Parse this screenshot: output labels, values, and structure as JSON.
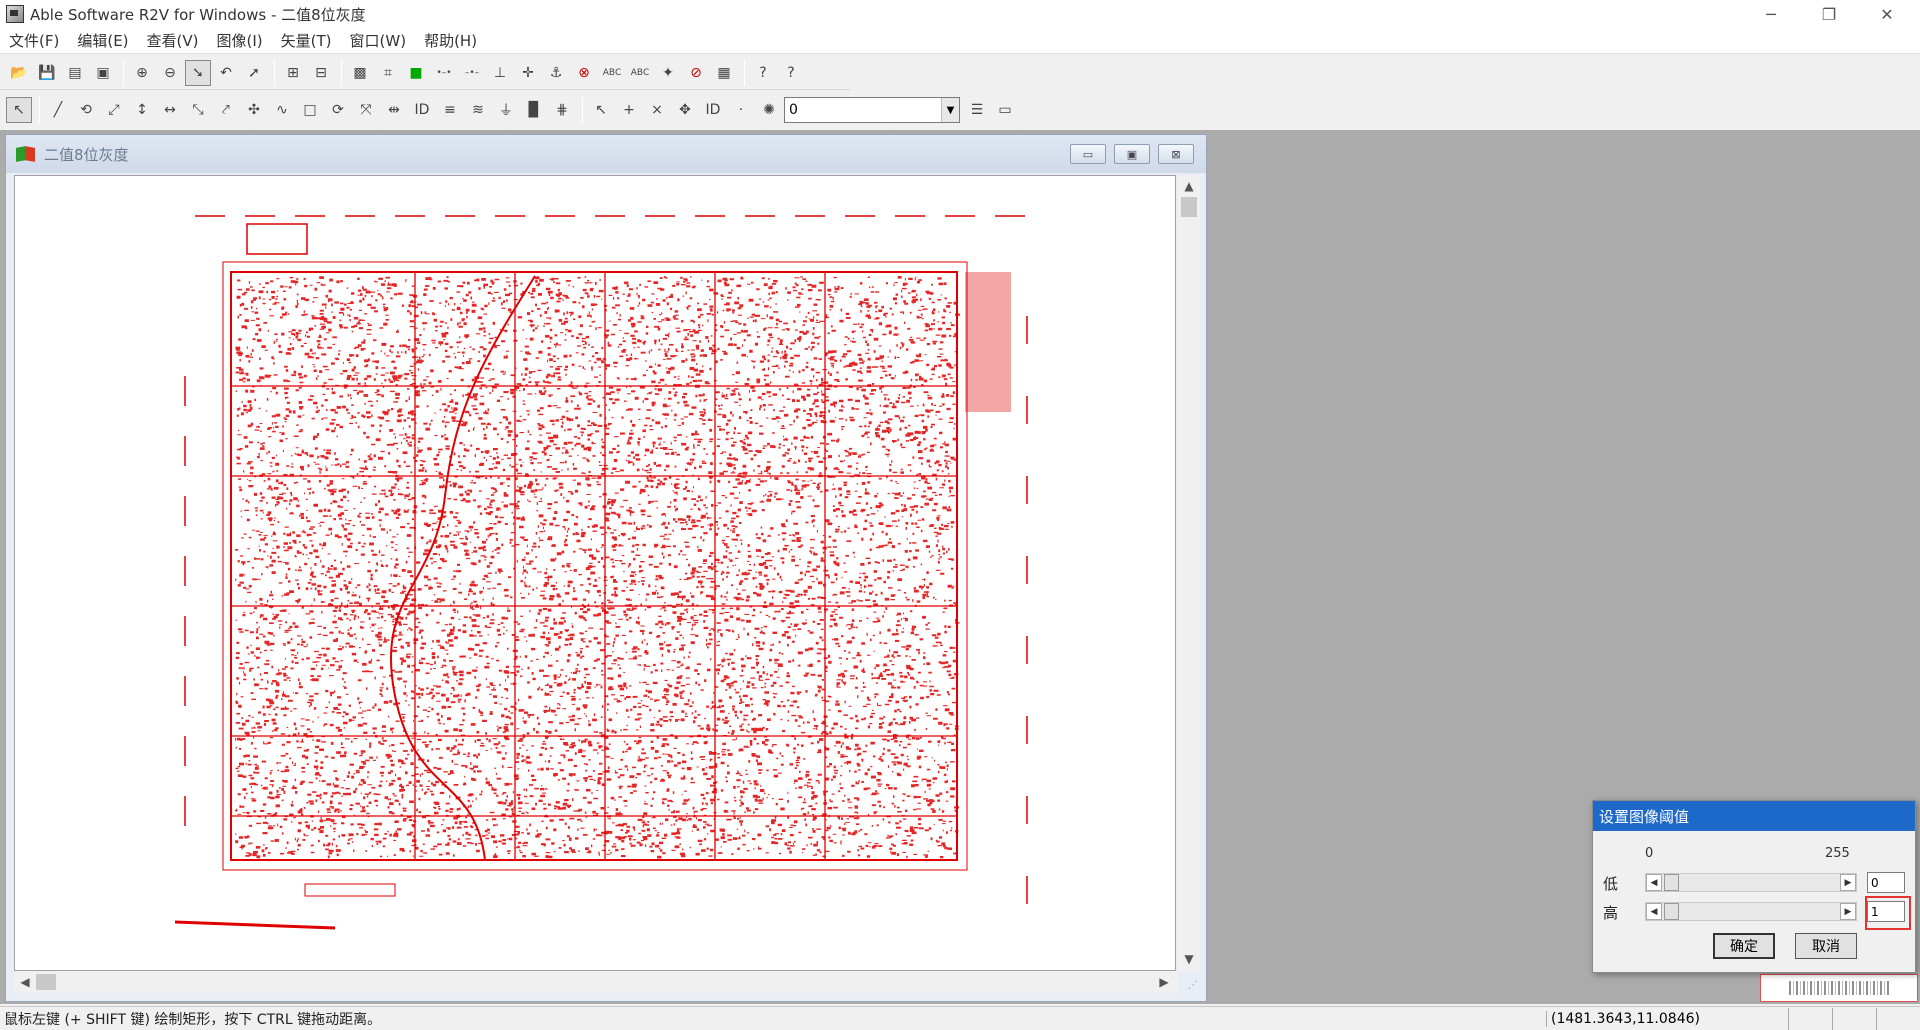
{
  "app": {
    "title": "Able Software R2V for Windows - 二值8位灰度",
    "icon": "r2v-app-icon",
    "window_controls": {
      "minimize": "─",
      "maximize": "❐",
      "close": "✕"
    }
  },
  "menu": [
    {
      "label": "文件(F)"
    },
    {
      "label": "编辑(E)"
    },
    {
      "label": "查看(V)"
    },
    {
      "label": "图像(I)"
    },
    {
      "label": "矢量(T)"
    },
    {
      "label": "窗口(W)"
    },
    {
      "label": "帮助(H)"
    }
  ],
  "toolbar1": {
    "buttons": [
      {
        "name": "open-icon",
        "glyph": "📂"
      },
      {
        "name": "save-icon",
        "glyph": "💾"
      },
      {
        "name": "print-icon",
        "glyph": "▤"
      },
      {
        "name": "save-all-icon",
        "glyph": "▣"
      },
      {
        "name": "zoom-in-icon",
        "glyph": "⊕"
      },
      {
        "name": "zoom-out-icon",
        "glyph": "⊖"
      },
      {
        "name": "select-arrow-icon",
        "glyph": "➘"
      },
      {
        "name": "undo-icon",
        "glyph": "↶"
      },
      {
        "name": "pointer-icon",
        "glyph": "➚"
      },
      {
        "name": "fit-width-icon",
        "glyph": "⊞"
      },
      {
        "name": "fit-height-icon",
        "glyph": "⊟"
      },
      {
        "name": "image-color-icon",
        "glyph": "▩"
      },
      {
        "name": "crop-icon",
        "glyph": "⌗"
      },
      {
        "name": "green-square-icon",
        "glyph": "■"
      },
      {
        "name": "node-link-icon",
        "glyph": "•–•"
      },
      {
        "name": "node-icon",
        "glyph": "–•–"
      },
      {
        "name": "split-icon",
        "glyph": "⊥"
      },
      {
        "name": "cross-icon",
        "glyph": "✛"
      },
      {
        "name": "anchor-icon",
        "glyph": "⚓"
      },
      {
        "name": "delete-icon",
        "glyph": "⊗"
      },
      {
        "name": "ocr-icon",
        "glyph": "ABC"
      },
      {
        "name": "ocr-label-icon",
        "glyph": "ABC"
      },
      {
        "name": "target-icon",
        "glyph": "✦"
      },
      {
        "name": "stop-pick-icon",
        "glyph": "⊘"
      },
      {
        "name": "map-icon",
        "glyph": "▦"
      },
      {
        "name": "help-icon",
        "glyph": "?"
      },
      {
        "name": "context-help-icon",
        "glyph": "?"
      }
    ]
  },
  "toolbar2": {
    "buttons": [
      {
        "name": "edit-pointer-icon",
        "glyph": "↖"
      },
      {
        "name": "draw-line-icon",
        "glyph": "╱"
      },
      {
        "name": "lasso-icon",
        "glyph": "⟲"
      },
      {
        "name": "trace-icon",
        "glyph": "⤢"
      },
      {
        "name": "vertical-split-icon",
        "glyph": "↕"
      },
      {
        "name": "horizontal-split-icon",
        "glyph": "↔"
      },
      {
        "name": "join-icon",
        "glyph": "⤡"
      },
      {
        "name": "extend-icon",
        "glyph": "⤤"
      },
      {
        "name": "node-edit-icon",
        "glyph": "✣"
      },
      {
        "name": "smooth-icon",
        "glyph": "∿"
      },
      {
        "name": "rect-select-icon",
        "glyph": "□"
      },
      {
        "name": "rotate-icon",
        "glyph": "⟳"
      },
      {
        "name": "stretch-icon",
        "glyph": "⤧"
      },
      {
        "name": "move-icon",
        "glyph": "⇹"
      },
      {
        "name": "label-id-icon",
        "glyph": "ID"
      },
      {
        "name": "attribute-icon",
        "glyph": "≡"
      },
      {
        "name": "contour-icon",
        "glyph": "≋"
      },
      {
        "name": "elevation-icon",
        "glyph": "⏚"
      },
      {
        "name": "fill-icon",
        "glyph": "▉"
      },
      {
        "name": "grid-icon",
        "glyph": "⋕"
      },
      {
        "name": "pick-point-icon",
        "glyph": "↖"
      },
      {
        "name": "add-point-icon",
        "glyph": "+"
      },
      {
        "name": "remove-point-icon",
        "glyph": "×"
      },
      {
        "name": "point-edit-icon",
        "glyph": "✥"
      },
      {
        "name": "point-id-icon",
        "glyph": "ID"
      },
      {
        "name": "point-label-icon",
        "glyph": "·"
      },
      {
        "name": "light-icon",
        "glyph": "✺"
      }
    ],
    "layer_value": "0",
    "after_buttons": [
      {
        "name": "layers-icon",
        "glyph": "☰"
      },
      {
        "name": "layer-properties-icon",
        "glyph": "▭"
      }
    ]
  },
  "document": {
    "title": "二值8位灰度",
    "controls": {
      "minimize": "▭",
      "maximize": "▣",
      "close": "⊠"
    },
    "map_color": "#e00000"
  },
  "dialog": {
    "title": "设置图像阈值",
    "scale_min": "0",
    "scale_max": "255",
    "low_label": "低",
    "high_label": "高",
    "low_value": "0",
    "high_value": "1",
    "ok": "确定",
    "cancel": "取消",
    "highlight_color": "#e33333"
  },
  "status": {
    "hint": "鼠标左键 (+ SHIFT 键) 绘制矩形，按下 CTRL 键拖动距离。",
    "coords": "(1481.3643,11.0846)"
  }
}
